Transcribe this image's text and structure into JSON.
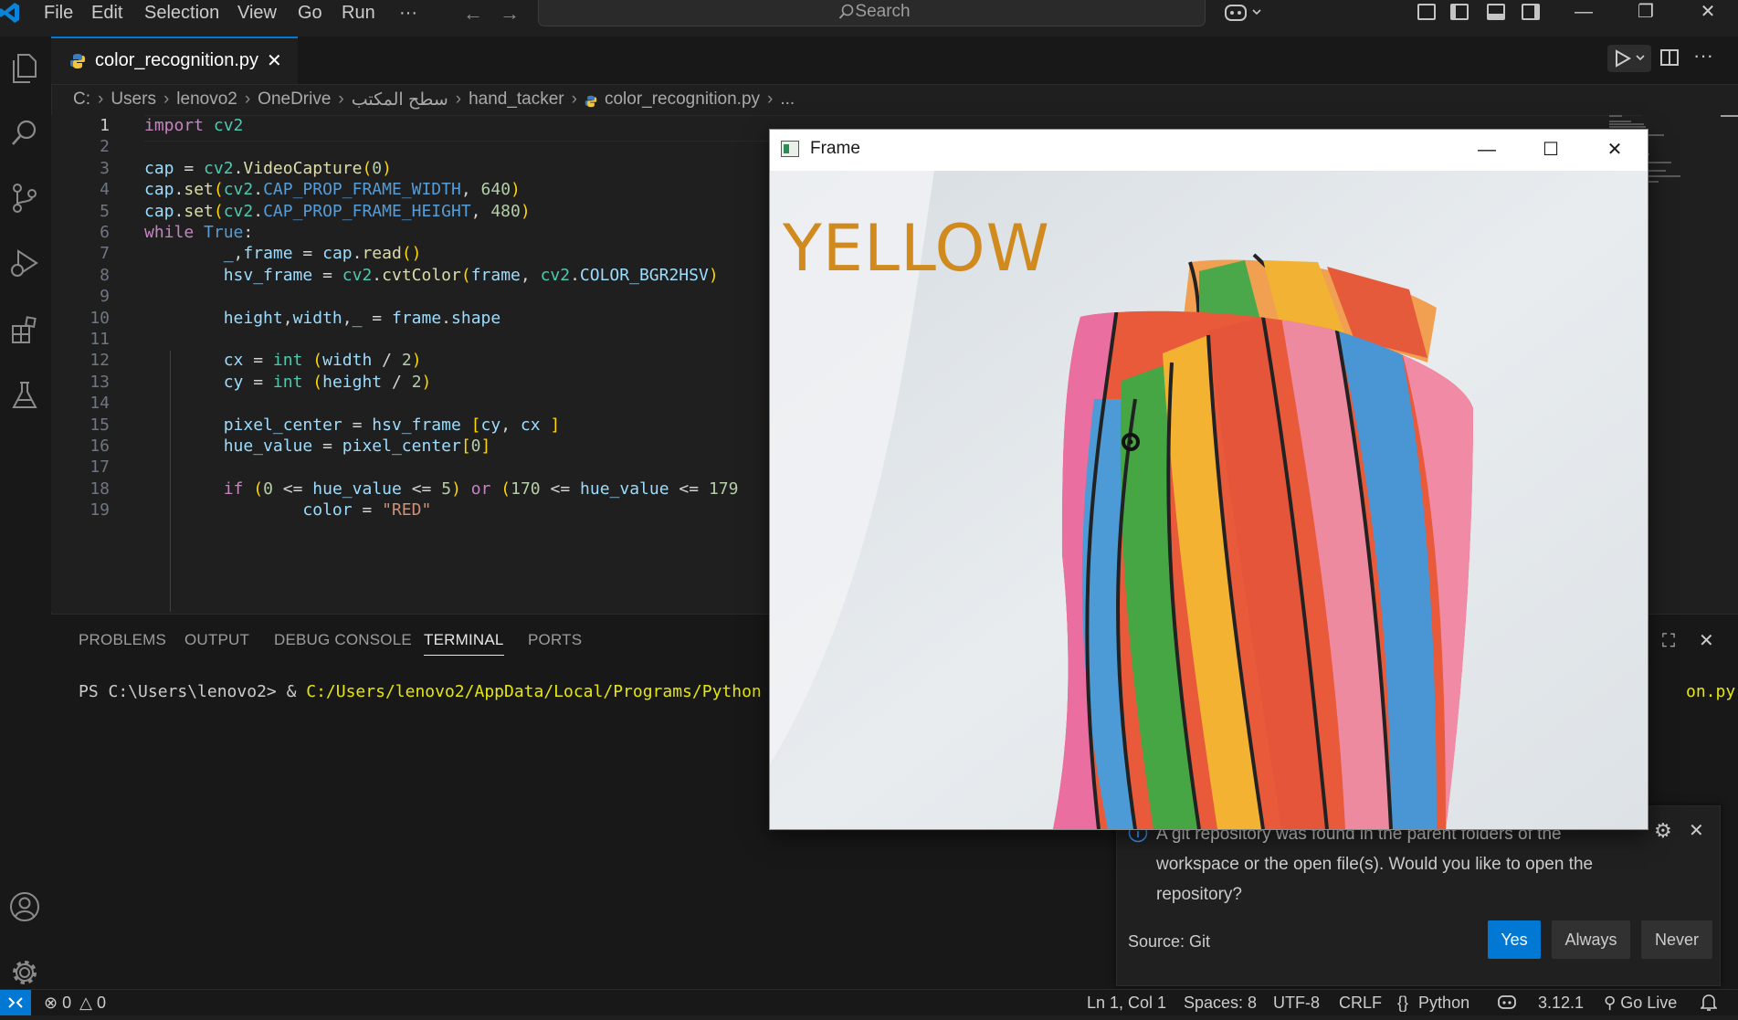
{
  "menu": {
    "items": [
      "File",
      "Edit",
      "Selection",
      "View",
      "Go",
      "Run"
    ],
    "more": "···"
  },
  "search": {
    "placeholder": "Search"
  },
  "tab": {
    "label": "color_recognition.py",
    "close": "✕"
  },
  "breadcrumb": [
    "C:",
    "Users",
    "lenovo2",
    "OneDrive",
    "سطح المكتب",
    "hand_tacker",
    "color_recognition.py",
    "..."
  ],
  "editor": {
    "current_line": 1,
    "lines": [
      {
        "n": "1",
        "code": "import cv2"
      },
      {
        "n": "2",
        "code": ""
      },
      {
        "n": "3",
        "code": "cap = cv2.VideoCapture(0)"
      },
      {
        "n": "4",
        "code": "cap.set(cv2.CAP_PROP_FRAME_WIDTH, 640)"
      },
      {
        "n": "5",
        "code": "cap.set(cv2.CAP_PROP_FRAME_HEIGHT, 480)"
      },
      {
        "n": "6",
        "code": "while True:"
      },
      {
        "n": "7",
        "code": "        _,frame = cap.read()"
      },
      {
        "n": "8",
        "code": "        hsv_frame = cv2.cvtColor(frame, cv2.COLOR_BGR2HSV)"
      },
      {
        "n": "9",
        "code": ""
      },
      {
        "n": "10",
        "code": "        height,width,_ = frame.shape"
      },
      {
        "n": "11",
        "code": ""
      },
      {
        "n": "12",
        "code": "        cx = int (width / 2)"
      },
      {
        "n": "13",
        "code": "        cy = int (height / 2)"
      },
      {
        "n": "14",
        "code": ""
      },
      {
        "n": "15",
        "code": "        pixel_center = hsv_frame [cy, cx ]"
      },
      {
        "n": "16",
        "code": "        hue_value = pixel_center[0]"
      },
      {
        "n": "17",
        "code": ""
      },
      {
        "n": "18",
        "code": "        if (0 <= hue_value <= 5) or (170 <= hue_value <= 179"
      },
      {
        "n": "19",
        "code": "                color = \"RED\""
      }
    ]
  },
  "panel": {
    "tabs": [
      "PROBLEMS",
      "OUTPUT",
      "DEBUG CONSOLE",
      "TERMINAL",
      "PORTS"
    ],
    "active_tab": "TERMINAL",
    "terminal_prompt": "PS C:\\Users\\lenovo2> & ",
    "terminal_path": "C:/Users/lenovo2/AppData/Local/Programs/Python",
    "terminal_tail": "on.py\""
  },
  "frame_window": {
    "title": "Frame",
    "detected_color": "YELLOW"
  },
  "notification": {
    "message": "A git repository was found in the parent folders of the workspace or the open file(s). Would you like to open the repository?",
    "source": "Source: Git",
    "buttons": [
      "Yes",
      "Always",
      "Never"
    ]
  },
  "statusbar": {
    "errors": "0",
    "warnings": "0",
    "position": "Ln 1, Col 1",
    "spaces": "Spaces: 8",
    "encoding": "UTF-8",
    "eol": "CRLF",
    "language": "Python",
    "python_version": "3.12.1",
    "golive": "Go Live"
  },
  "colors": {
    "accent": "#0078d4",
    "detected_text": "#d08a1d"
  }
}
